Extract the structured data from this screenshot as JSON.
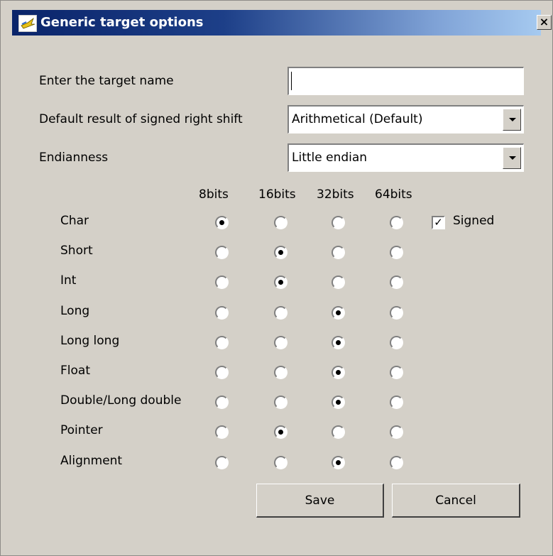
{
  "window": {
    "title": "Generic target options",
    "close_glyph": "×",
    "icon": "app-icon"
  },
  "form": {
    "target_name_label": "Enter the target name",
    "target_name_value": "",
    "shift_label": "Default result of signed right shift",
    "shift_value": "Arithmetical (Default)",
    "endianness_label": "Endianness",
    "endianness_value": "Little endian"
  },
  "grid": {
    "columns": [
      "8bits",
      "16bits",
      "32bits",
      "64bits"
    ],
    "rows": [
      {
        "label": "Char",
        "selected": "8bits"
      },
      {
        "label": "Short",
        "selected": "16bits"
      },
      {
        "label": "Int",
        "selected": "16bits"
      },
      {
        "label": "Long",
        "selected": "32bits"
      },
      {
        "label": "Long long",
        "selected": "32bits"
      },
      {
        "label": "Float",
        "selected": "32bits"
      },
      {
        "label": "Double/Long double",
        "selected": "32bits"
      },
      {
        "label": "Pointer",
        "selected": "16bits"
      },
      {
        "label": "Alignment",
        "selected": "32bits"
      }
    ],
    "signed_label": "Signed",
    "signed_checked": true
  },
  "buttons": {
    "save": "Save",
    "cancel": "Cancel"
  }
}
